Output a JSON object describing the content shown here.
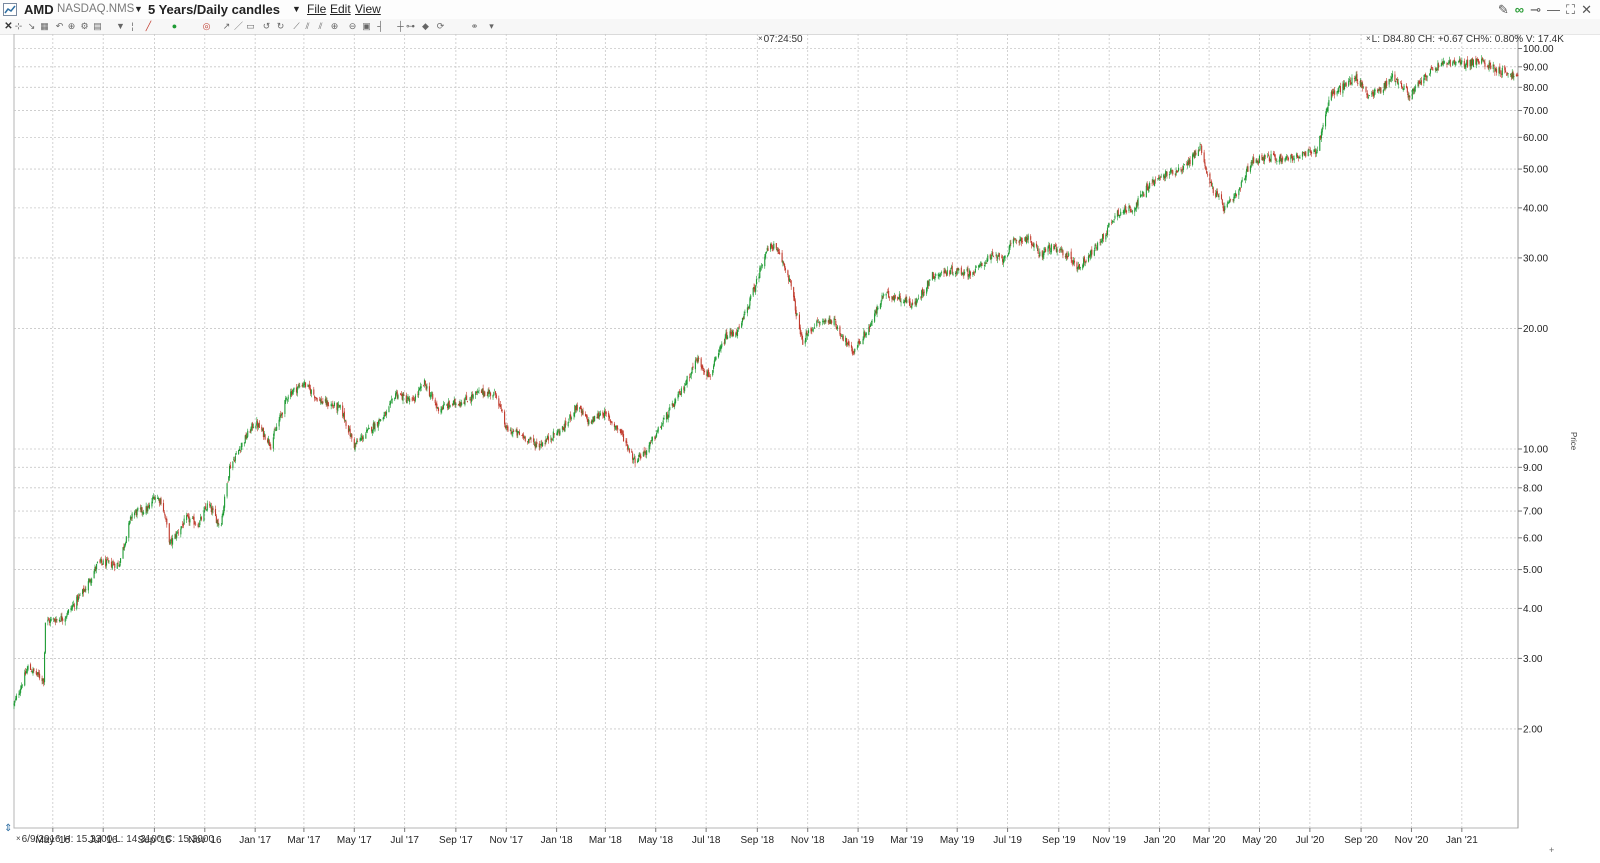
{
  "window": {
    "symbol": "AMD",
    "exchange": "NASDAQ.NMS",
    "period": "5 Years/Daily candles",
    "menus": [
      "File",
      "Edit",
      "View"
    ],
    "window_controls": [
      "pencil-icon",
      "link-icon",
      "pin-icon",
      "minimize-icon",
      "maximize-icon",
      "close-icon"
    ]
  },
  "toolbar": {
    "icons": [
      "close-icon",
      "crosshair-icon",
      "trend-line-icon",
      "grid-icon",
      "undo-icon",
      "zoom-icon",
      "settings-icon",
      "layout-icon",
      "filter-icon",
      "bar-type-icon",
      "pencil-icon",
      "circle-icon",
      "target-icon",
      "arrow-icon",
      "line-icon",
      "box-icon",
      "rotate-left-icon",
      "rotate-right-icon",
      "fan-icon",
      "channel-icon",
      "channel2-icon",
      "zoom-in-icon",
      "zoom-out-icon",
      "reset-icon",
      "bar-icon",
      "crosshair2-icon",
      "period-icon",
      "shield-icon",
      "refresh-icon",
      "link-icon",
      "dropdown-icon"
    ]
  },
  "header": {
    "clock": "07:24:50",
    "quote_line": "L: D84.80 CH: +0.67 CH%: 0.80% V: 17.4K",
    "cursor_ohlc": "6/9/2016  H: 15.3300  L: 14.3100  C: 15.3000"
  },
  "colors": {
    "up": "#1e9b34",
    "down": "#c0392b",
    "grid": "#c8c8c8",
    "background": "#ffffff"
  },
  "chart_data": {
    "type": "candlestick",
    "y_scale": "log",
    "ylim": [
      1.45,
      112
    ],
    "ylabel": "Price",
    "y_ticks": [
      2,
      3,
      4,
      5,
      6,
      7,
      8,
      9,
      10,
      20,
      30,
      40,
      50,
      60,
      70,
      80,
      90,
      100
    ],
    "y_tick_labels": [
      "2.00",
      "3.00",
      "4.00",
      "5.00",
      "6.00",
      "7.00",
      "8.00",
      "9.00",
      "10.00",
      "20.00",
      "30.00",
      "40.00",
      "50.00",
      "60.00",
      "70.00",
      "80.00",
      "90.00",
      "100.00"
    ],
    "x_range": [
      "2016-03-15",
      "2021-03-10"
    ],
    "x_ticks": [
      "2016-05-01",
      "2016-07-01",
      "2016-09-01",
      "2016-11-01",
      "2017-01-01",
      "2017-03-01",
      "2017-05-01",
      "2017-07-01",
      "2017-09-01",
      "2017-11-01",
      "2018-01-01",
      "2018-03-01",
      "2018-05-01",
      "2018-07-01",
      "2018-09-01",
      "2018-11-01",
      "2019-01-01",
      "2019-03-01",
      "2019-05-01",
      "2019-07-01",
      "2019-09-01",
      "2019-11-01",
      "2020-01-01",
      "2020-03-01",
      "2020-05-01",
      "2020-07-01",
      "2020-09-01",
      "2020-11-01",
      "2021-01-01"
    ],
    "x_tick_labels": [
      "May '16",
      "Jul '16",
      "Sep '16",
      "Nov '16",
      "Jan '17",
      "Mar '17",
      "May '17",
      "Jul '17",
      "Sep '17",
      "Nov '17",
      "Jan '18",
      "Mar '18",
      "May '18",
      "Jul '18",
      "Sep '18",
      "Nov '18",
      "Jan '19",
      "Mar '19",
      "May '19",
      "Jul '19",
      "Sep '19",
      "Nov '19",
      "Jan '20",
      "Mar '20",
      "May '20",
      "Jul '20",
      "Sep '20",
      "Nov '20",
      "Jan '21"
    ],
    "close_path": [
      [
        "2016-03-15",
        2.3
      ],
      [
        "2016-04-01",
        2.85
      ],
      [
        "2016-04-20",
        2.65
      ],
      [
        "2016-04-22",
        3.7
      ],
      [
        "2016-05-15",
        3.8
      ],
      [
        "2016-06-10",
        4.5
      ],
      [
        "2016-06-25",
        5.2
      ],
      [
        "2016-07-20",
        5.15
      ],
      [
        "2016-08-05",
        6.9
      ],
      [
        "2016-08-25",
        7.1
      ],
      [
        "2016-09-01",
        7.65
      ],
      [
        "2016-09-10",
        7.4
      ],
      [
        "2016-09-20",
        5.8
      ],
      [
        "2016-10-10",
        6.7
      ],
      [
        "2016-10-25",
        6.5
      ],
      [
        "2016-11-05",
        7.3
      ],
      [
        "2016-11-20",
        6.4
      ],
      [
        "2016-12-01",
        9.0
      ],
      [
        "2016-12-15",
        10.2
      ],
      [
        "2017-01-01",
        11.7
      ],
      [
        "2017-01-20",
        10.3
      ],
      [
        "2017-02-10",
        13.7
      ],
      [
        "2017-03-01",
        14.6
      ],
      [
        "2017-03-20",
        13.2
      ],
      [
        "2017-04-15",
        12.6
      ],
      [
        "2017-05-01",
        10.2
      ],
      [
        "2017-05-20",
        11.2
      ],
      [
        "2017-06-10",
        12.3
      ],
      [
        "2017-06-20",
        13.8
      ],
      [
        "2017-07-10",
        13.1
      ],
      [
        "2017-07-25",
        14.6
      ],
      [
        "2017-08-10",
        12.6
      ],
      [
        "2017-08-25",
        12.9
      ],
      [
        "2017-09-15",
        13.3
      ],
      [
        "2017-10-01",
        13.9
      ],
      [
        "2017-10-20",
        13.7
      ],
      [
        "2017-11-01",
        11.2
      ],
      [
        "2017-11-20",
        10.8
      ],
      [
        "2017-12-10",
        10.2
      ],
      [
        "2018-01-10",
        11.3
      ],
      [
        "2018-01-25",
        12.8
      ],
      [
        "2018-02-10",
        11.6
      ],
      [
        "2018-02-25",
        12.4
      ],
      [
        "2018-03-20",
        11.0
      ],
      [
        "2018-04-05",
        9.4
      ],
      [
        "2018-04-20",
        9.9
      ],
      [
        "2018-05-10",
        11.7
      ],
      [
        "2018-06-01",
        13.9
      ],
      [
        "2018-06-20",
        16.8
      ],
      [
        "2018-07-05",
        15.2
      ],
      [
        "2018-07-25",
        19.1
      ],
      [
        "2018-08-10",
        19.8
      ],
      [
        "2018-08-30",
        25.7
      ],
      [
        "2018-09-10",
        30.8
      ],
      [
        "2018-09-20",
        32.3
      ],
      [
        "2018-10-01",
        29.5
      ],
      [
        "2018-10-10",
        26.6
      ],
      [
        "2018-10-25",
        18.5
      ],
      [
        "2018-11-10",
        20.5
      ],
      [
        "2018-12-01",
        21.1
      ],
      [
        "2018-12-25",
        17.4
      ],
      [
        "2019-01-15",
        20.2
      ],
      [
        "2019-02-01",
        24.3
      ],
      [
        "2019-02-20",
        23.9
      ],
      [
        "2019-03-10",
        22.8
      ],
      [
        "2019-04-01",
        27.1
      ],
      [
        "2019-04-25",
        27.9
      ],
      [
        "2019-05-20",
        27.5
      ],
      [
        "2019-06-10",
        30.3
      ],
      [
        "2019-06-25",
        29.8
      ],
      [
        "2019-07-10",
        33.2
      ],
      [
        "2019-07-25",
        33.6
      ],
      [
        "2019-08-10",
        30.5
      ],
      [
        "2019-08-20",
        31.9
      ],
      [
        "2019-09-10",
        30.7
      ],
      [
        "2019-09-25",
        28.4
      ],
      [
        "2019-10-20",
        32.6
      ],
      [
        "2019-11-10",
        38.9
      ],
      [
        "2019-12-01",
        40.1
      ],
      [
        "2019-12-20",
        45.8
      ],
      [
        "2020-01-10",
        48.6
      ],
      [
        "2020-02-01",
        50.7
      ],
      [
        "2020-02-20",
        57.0
      ],
      [
        "2020-03-01",
        46.4
      ],
      [
        "2020-03-20",
        39.8
      ],
      [
        "2020-04-05",
        43.4
      ],
      [
        "2020-04-20",
        52.0
      ],
      [
        "2020-05-05",
        53.6
      ],
      [
        "2020-05-25",
        53.2
      ],
      [
        "2020-06-20",
        53.8
      ],
      [
        "2020-07-10",
        55.9
      ],
      [
        "2020-07-25",
        76.2
      ],
      [
        "2020-08-10",
        80.1
      ],
      [
        "2020-08-25",
        84.9
      ],
      [
        "2020-09-10",
        76.5
      ],
      [
        "2020-09-25",
        78.9
      ],
      [
        "2020-10-10",
        85.5
      ],
      [
        "2020-10-30",
        76.2
      ],
      [
        "2020-11-20",
        86.2
      ],
      [
        "2020-12-10",
        92.1
      ],
      [
        "2021-01-05",
        91.8
      ],
      [
        "2021-01-25",
        92.8
      ],
      [
        "2021-02-10",
        89.2
      ],
      [
        "2021-03-10",
        84.8
      ]
    ]
  }
}
